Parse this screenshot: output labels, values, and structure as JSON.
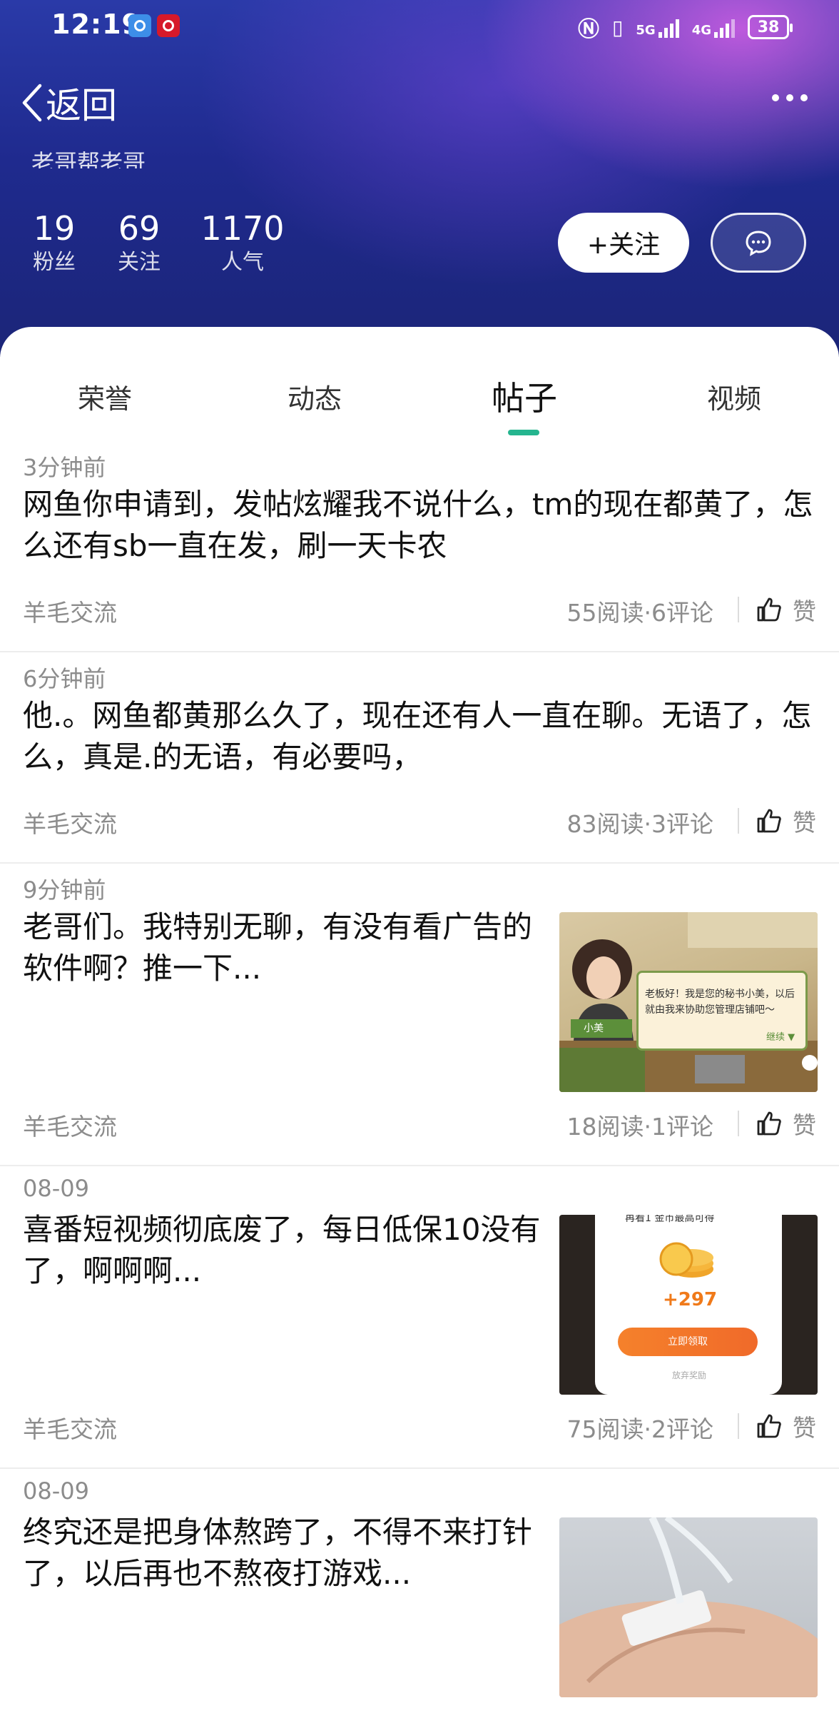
{
  "status_bar": {
    "time": "12:19",
    "net_5g": "5G",
    "net_4g": "4G",
    "battery": "38"
  },
  "nav": {
    "back_label": "返回"
  },
  "profile": {
    "slogan": "老哥帮老哥",
    "stats": [
      {
        "value": "19",
        "label": "粉丝"
      },
      {
        "value": "69",
        "label": "关注"
      },
      {
        "value": "1170",
        "label": "人气"
      }
    ],
    "follow_label": "+关注"
  },
  "tabs": [
    {
      "label": "荣誉",
      "active": false
    },
    {
      "label": "动态",
      "active": false
    },
    {
      "label": "帖子",
      "active": true
    },
    {
      "label": "视频",
      "active": false
    }
  ],
  "posts": [
    {
      "time": "3分钟前",
      "title": "网鱼你申请到，发帖炫耀我不说什么，tm的现在都黄了，怎么还有sb一直在发，刷一天卡农",
      "category": "羊毛交流",
      "meta": "55阅读·6评论",
      "like_label": "赞"
    },
    {
      "time": "6分钟前",
      "title": "他.。网鱼都黄那么久了，现在还有人一直在聊。无语了，怎么，真是.的无语，有必要吗，",
      "category": "羊毛交流",
      "meta": "83阅读·3评论",
      "like_label": "赞"
    },
    {
      "time": "9分钟前",
      "title": "老哥们。我特别无聊，有没有看广告的软件啊？推一下...",
      "category": "羊毛交流",
      "meta": "18阅读·1评论",
      "like_label": "赞",
      "thumb": {
        "bubble_text": "老板好！我是您的秘书小美，以后就由我来协助您管理店铺吧～",
        "name_tag": "小美",
        "continue": "继续 ▼"
      }
    },
    {
      "time": "08-09",
      "title": "喜番短视频彻底废了，每日低保10没有了，啊啊啊...",
      "category": "羊毛交流",
      "meta": "75阅读·2评论",
      "like_label": "赞",
      "thumb": {
        "top_text": "再看1 金币最高可得",
        "amount": "+297",
        "button": "立即领取",
        "skip": "放弃奖励"
      }
    },
    {
      "time": "08-09",
      "title": "终究还是把身体熬跨了，不得不来打针了，以后再也不熬夜打游戏..."
    }
  ],
  "colors": {
    "accent": "#25b58f",
    "header_dark": "#1b2578",
    "header_pink": "#d660e6"
  }
}
